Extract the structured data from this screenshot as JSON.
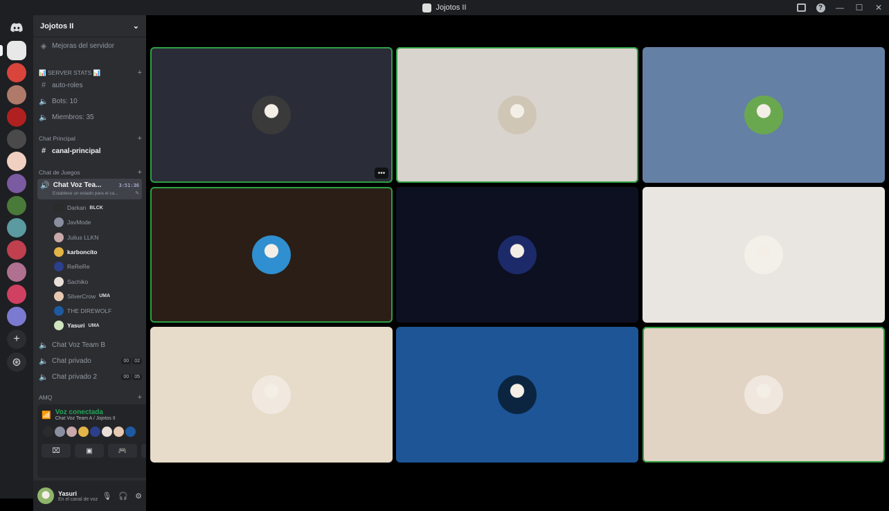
{
  "window": {
    "title": "Jojotos II"
  },
  "sidebar": {
    "server_name": "Jojotos II",
    "boost_label": "Mejoras del servidor",
    "categories": {
      "stats": "📊 SERVER STATS 📊",
      "principal": "Chat Principal",
      "juegos": "Chat de Juegos",
      "amq": "AMQ"
    },
    "channels": {
      "auto_roles": "auto-roles",
      "bots": "Bots: 10",
      "miembros": "Miembros: 35",
      "canal_principal": "canal-principal",
      "vc_team_a": "Chat Voz Tea...",
      "vc_time": "3:51:36",
      "vc_status": "Establece un estado para el ca...",
      "vc_team_b": "Chat Voz Team B",
      "privado": "Chat privado",
      "privado_counts": [
        "00",
        "02"
      ],
      "privado2": "Chat privado 2",
      "privado2_counts": [
        "00",
        "05"
      ]
    },
    "members": [
      {
        "name": "Darkan",
        "tag": "BLCK",
        "color": "#2b2b2b"
      },
      {
        "name": "JavMode",
        "tag": "",
        "color": "#8a8fa0"
      },
      {
        "name": "Julius LLKN",
        "tag": "",
        "color": "#c9a9a9"
      },
      {
        "name": "karboncito",
        "tag": "",
        "color": "#e3b447"
      },
      {
        "name": "ReReRe",
        "tag": "",
        "color": "#2c3f8a"
      },
      {
        "name": "Sachiko",
        "tag": "",
        "color": "#e8dfd8"
      },
      {
        "name": "SilverCrow",
        "tag": "UMA",
        "color": "#e5c9b0"
      },
      {
        "name": "THE DIREWOLF",
        "tag": "",
        "color": "#1f5aa0"
      },
      {
        "name": "Yasuri",
        "tag": "UMA",
        "color": "#cfe5c0"
      }
    ]
  },
  "voice_panel": {
    "status": "Voz conectada",
    "location": "Chat Voz Team A / Jojotos II",
    "avatar_colors": [
      "#2b2b2b",
      "#8a8fa0",
      "#c9a9a9",
      "#e3b447",
      "#2c3f8a",
      "#e8dfd8",
      "#e5c9b0",
      "#1f5aa0"
    ]
  },
  "user": {
    "name": "Yasuri",
    "status": "En el canal de voz"
  },
  "tiles": [
    {
      "bg": "#2a2c38",
      "avatar": "#3a3a3a",
      "speaking": true
    },
    {
      "bg": "#d9d4ce",
      "avatar": "#cfc6b6",
      "speaking": true
    },
    {
      "bg": "#6480a4",
      "avatar": "#6aa84f",
      "speaking": false
    },
    {
      "bg": "#2a1e16",
      "avatar": "#2f8fd0",
      "speaking": true
    },
    {
      "bg": "#0c1020",
      "avatar": "#1c2a6a",
      "speaking": false
    },
    {
      "bg": "#e9e5e0",
      "avatar": "#f3efe9",
      "speaking": false
    },
    {
      "bg": "#e6dcc9",
      "avatar": "#f1e9e0",
      "speaking": false
    },
    {
      "bg": "#1d5597",
      "avatar": "#0b2540",
      "speaking": false
    },
    {
      "bg": "#e2d4c4",
      "avatar": "#f0e8df",
      "speaking": true
    }
  ],
  "guild_colors": [
    "#e8e8e8",
    "#d9443b",
    "#b07a6a",
    "#b02020",
    "#4a4a4a",
    "#f0d0c0",
    "#7a5aa0",
    "#4a7a3a",
    "#5a9aa0",
    "#c04050",
    "#b07090",
    "#d04060",
    "#7a7ad0"
  ]
}
